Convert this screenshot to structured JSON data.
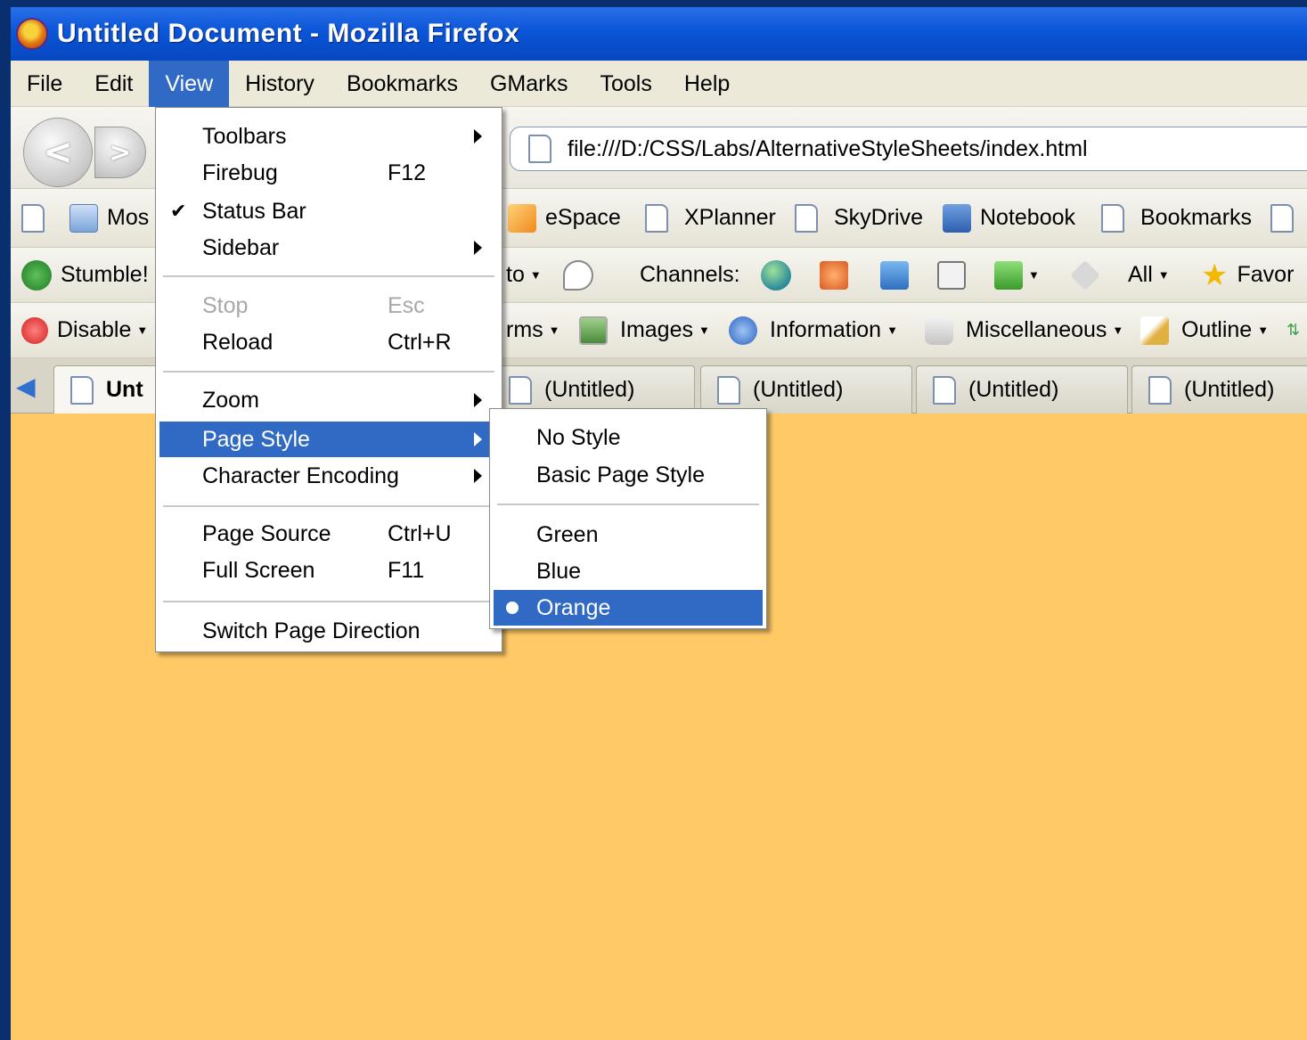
{
  "window": {
    "title": "Untitled Document - Mozilla Firefox"
  },
  "menubar": {
    "items": [
      "File",
      "Edit",
      "View",
      "History",
      "Bookmarks",
      "GMarks",
      "Tools",
      "Help"
    ],
    "active": "View"
  },
  "nav": {
    "back_glyph": "<",
    "forward_glyph": ">",
    "url": "file:///D:/CSS/Labs/AlternativeStyleSheets/index.html"
  },
  "bookmarks_toolbar": {
    "items": [
      "Mos",
      "eSpace",
      "XPlanner",
      "SkyDrive",
      "Notebook",
      "Bookmarks"
    ]
  },
  "stumble_toolbar": {
    "stumble_label": "Stumble!",
    "to_label": "to",
    "channels_label": "Channels:",
    "all_label": "All",
    "favor_label": "Favor"
  },
  "webdev_toolbar": {
    "disable_label": "Disable",
    "forms_label": "rms",
    "images_label": "Images",
    "information_label": "Information",
    "misc_label": "Miscellaneous",
    "outline_label": "Outline"
  },
  "tabs": {
    "items": [
      "Unt",
      "(Untitled)",
      "(Untitled)",
      "(Untitled)",
      "(Untitled)"
    ],
    "selected_index": 0
  },
  "view_menu": {
    "items": [
      {
        "label": "Toolbars",
        "shortcut": "",
        "submenu": true
      },
      {
        "label": "Firebug",
        "shortcut": "F12"
      },
      {
        "label": "Status Bar",
        "shortcut": "",
        "checked": true
      },
      {
        "label": "Sidebar",
        "shortcut": "",
        "submenu": true
      },
      {
        "label": "Stop",
        "shortcut": "Esc",
        "disabled": true
      },
      {
        "label": "Reload",
        "shortcut": "Ctrl+R"
      },
      {
        "label": "Zoom",
        "shortcut": "",
        "submenu": true
      },
      {
        "label": "Page Style",
        "shortcut": "",
        "submenu": true,
        "highlighted": true
      },
      {
        "label": "Character Encoding",
        "shortcut": "",
        "submenu": true
      },
      {
        "label": "Page Source",
        "shortcut": "Ctrl+U"
      },
      {
        "label": "Full Screen",
        "shortcut": "F11"
      },
      {
        "label": "Switch Page Direction",
        "shortcut": ""
      }
    ]
  },
  "page_style_menu": {
    "items": [
      {
        "label": "No Style"
      },
      {
        "label": "Basic Page Style"
      },
      {
        "label": "Green"
      },
      {
        "label": "Blue"
      },
      {
        "label": "Orange",
        "selected": true,
        "highlighted": true
      }
    ]
  },
  "colors": {
    "page_background": "#ffc966",
    "selection": "#316ac5",
    "titlebar": "#0a55d8",
    "desktop": "#0a2f6e"
  }
}
